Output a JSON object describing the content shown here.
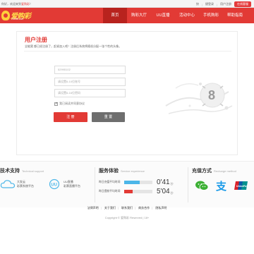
{
  "topbar": {
    "welcome_prefix": "你好，欢迎来到",
    "site_name": "爱购彩",
    "separator": "！",
    "links": [
      "快",
      "捷登录",
      "用户注册"
    ],
    "online_btn": "在线客服"
  },
  "logo": {
    "text": "爱购彩",
    "sub": "23638.com"
  },
  "nav": [
    {
      "label": "首页",
      "active": true
    },
    {
      "label": "购彩大厅",
      "active": false
    },
    {
      "label": "UU直播",
      "active": false
    },
    {
      "label": "活动中心",
      "active": false
    },
    {
      "label": "手机购彩",
      "active": false
    },
    {
      "label": "帮助指南",
      "active": false
    }
  ],
  "register": {
    "title": "用户注册",
    "desc": "全能窝 都已经注册了，赶紧加入吧！注册后系统将随机分配一张个性的头像。",
    "fields": [
      {
        "label": "邀请码：",
        "placeholder": "52995102"
      },
      {
        "label": "设置账号：",
        "placeholder": "请设置6-10位账号"
      },
      {
        "label": "设置密码：",
        "placeholder": "请设置6-16位密码"
      }
    ],
    "remember": "我已阅读并同意协议",
    "register_btn": "注 册",
    "reset_btn": "重 置"
  },
  "tech": {
    "title": "技术支持",
    "title_en": "Technical support",
    "items": [
      {
        "line1": "大发云",
        "line2": "彩票系统平台"
      },
      {
        "line1": "UU直播",
        "line2": "彩票直播平台"
      }
    ]
  },
  "service": {
    "title": "服务体验",
    "title_en": "Service experience",
    "rows": [
      {
        "label": "昨日充值平均时间",
        "value": "0'41",
        "unit": "秒",
        "fill": 0.55,
        "color": "#4cb6e8"
      },
      {
        "label": "昨日提款平均时间",
        "value": "5'04",
        "unit": "秒",
        "fill": 0.3,
        "color": "#e23a35"
      }
    ]
  },
  "payment": {
    "title": "充值方式",
    "title_en": "Recharge method",
    "icons": [
      "wechat-icon",
      "alipay-icon",
      "unionpay-icon"
    ]
  },
  "footer": {
    "links": [
      "法律声明",
      "关于我们",
      "联系我们",
      "商务合作",
      "隐私声明"
    ],
    "copyright": "Copyright © 爱购彩 Reserved | 18+"
  },
  "colors": {
    "brand": "#e23a35",
    "nav_active": "#b8231e",
    "reset": "#6e6e6e"
  }
}
